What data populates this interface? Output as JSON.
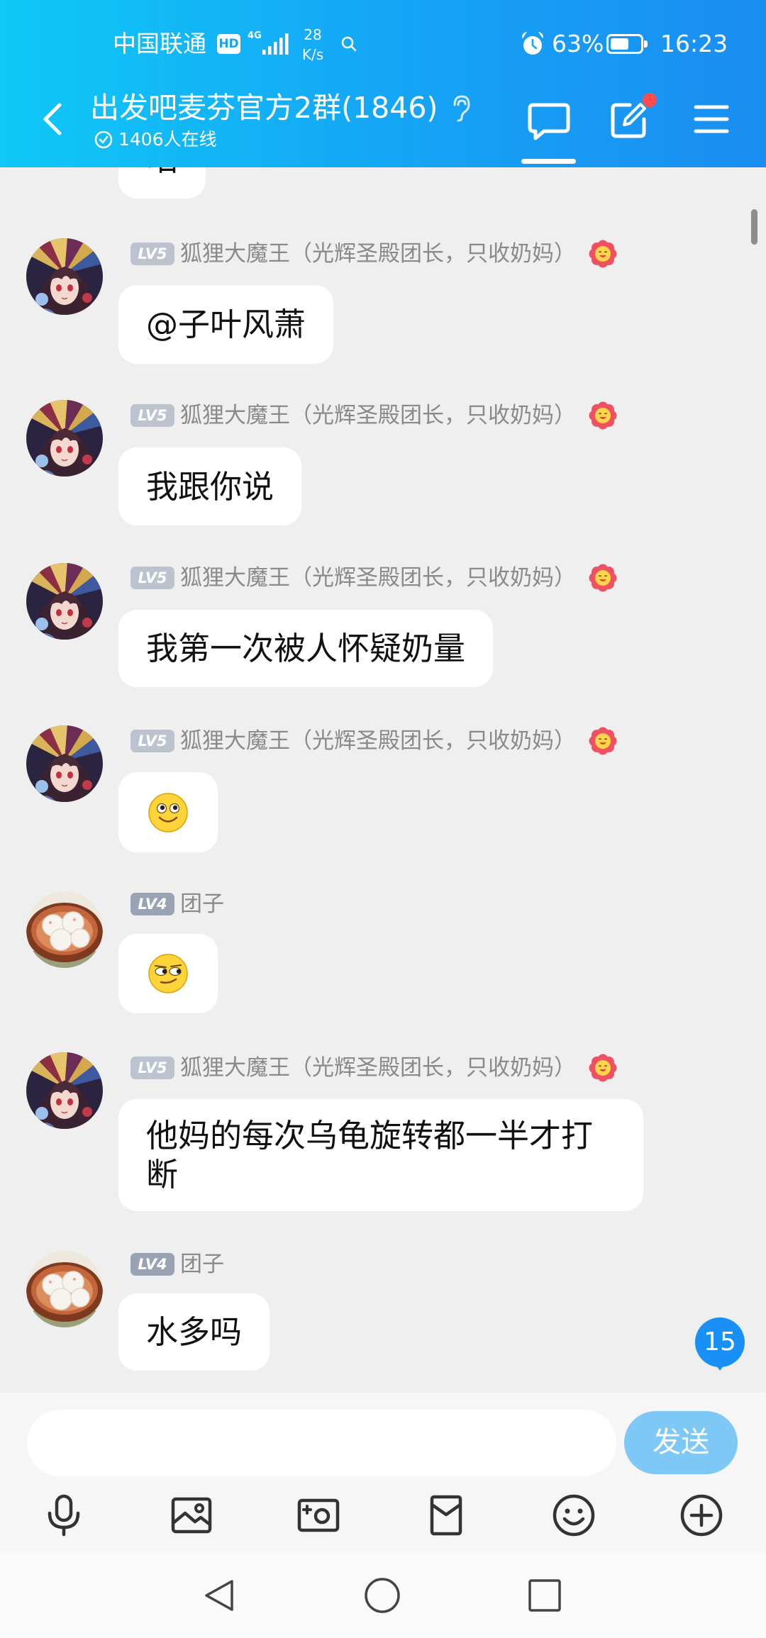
{
  "status_bar": {
    "carrier": "中国联通",
    "hd_badge": "HD",
    "network_type": "4G",
    "net_speed_value": "28",
    "net_speed_unit": "K/s",
    "battery_percent": "63%",
    "battery_level": 0.63,
    "time": "16:23",
    "icons": [
      "hd-icon",
      "signal-icon",
      "search-icon",
      "alarm-icon",
      "battery-icon"
    ]
  },
  "header": {
    "title": "出发吧麦芬官方2群(1846)",
    "online_count": "1406人在线",
    "icons": {
      "back": "chevron-left-icon",
      "listen": "ear-icon",
      "online": "check-circle-icon",
      "chat": "chat-bubble-icon",
      "notice": "edit-icon",
      "menu": "menu-icon"
    },
    "active_tab": "chat",
    "notice_has_dot": true
  },
  "partial_message": {
    "text": "咱"
  },
  "messages": [
    {
      "level": "LV5",
      "sender": "狐狸大魔王（光辉圣殿团长，只收奶妈）",
      "avatar_icon": "anime-girl-avatar",
      "badge_icon": "flower-icon",
      "text": "@子叶风萧"
    },
    {
      "level": "LV5",
      "sender": "狐狸大魔王（光辉圣殿团长，只收奶妈）",
      "avatar_icon": "anime-girl-avatar",
      "badge_icon": "flower-icon",
      "text": "我跟你说"
    },
    {
      "level": "LV5",
      "sender": "狐狸大魔王（光辉圣殿团长，只收奶妈）",
      "avatar_icon": "anime-girl-avatar",
      "badge_icon": "flower-icon",
      "text": "我第一次被人怀疑奶量"
    },
    {
      "level": "LV5",
      "sender": "狐狸大魔王（光辉圣殿团长，只收奶妈）",
      "avatar_icon": "anime-girl-avatar",
      "badge_icon": "flower-icon",
      "emoji": "smile-emoji"
    },
    {
      "level": "LV4",
      "sender": "团子",
      "avatar_icon": "dumplings-avatar",
      "emoji": "smirk-emoji"
    },
    {
      "level": "LV5",
      "sender": "狐狸大魔王（光辉圣殿团长，只收奶妈）",
      "avatar_icon": "anime-girl-avatar",
      "badge_icon": "flower-icon",
      "text": "他妈的每次乌龟旋转都一半才打断"
    },
    {
      "level": "LV4",
      "sender": "团子",
      "avatar_icon": "dumplings-avatar",
      "text": "水多吗"
    }
  ],
  "unread_badge": "15",
  "input": {
    "value": "",
    "send_label": "发送"
  },
  "toolbar": [
    "microphone-icon",
    "image-icon",
    "camera-icon",
    "red-packet-icon",
    "emoji-icon",
    "plus-circle-icon"
  ],
  "nav_bar": [
    "back-triangle-icon",
    "home-circle-icon",
    "recents-square-icon"
  ],
  "colors": {
    "header_start": "#0fc8f7",
    "header_end": "#1a8df2",
    "chat_background": "#efefef",
    "bubble": "#ffffff",
    "send_button": "#7ec8f6",
    "unread_badge": "#1890f5",
    "notice_dot": "#ff4d4f"
  }
}
